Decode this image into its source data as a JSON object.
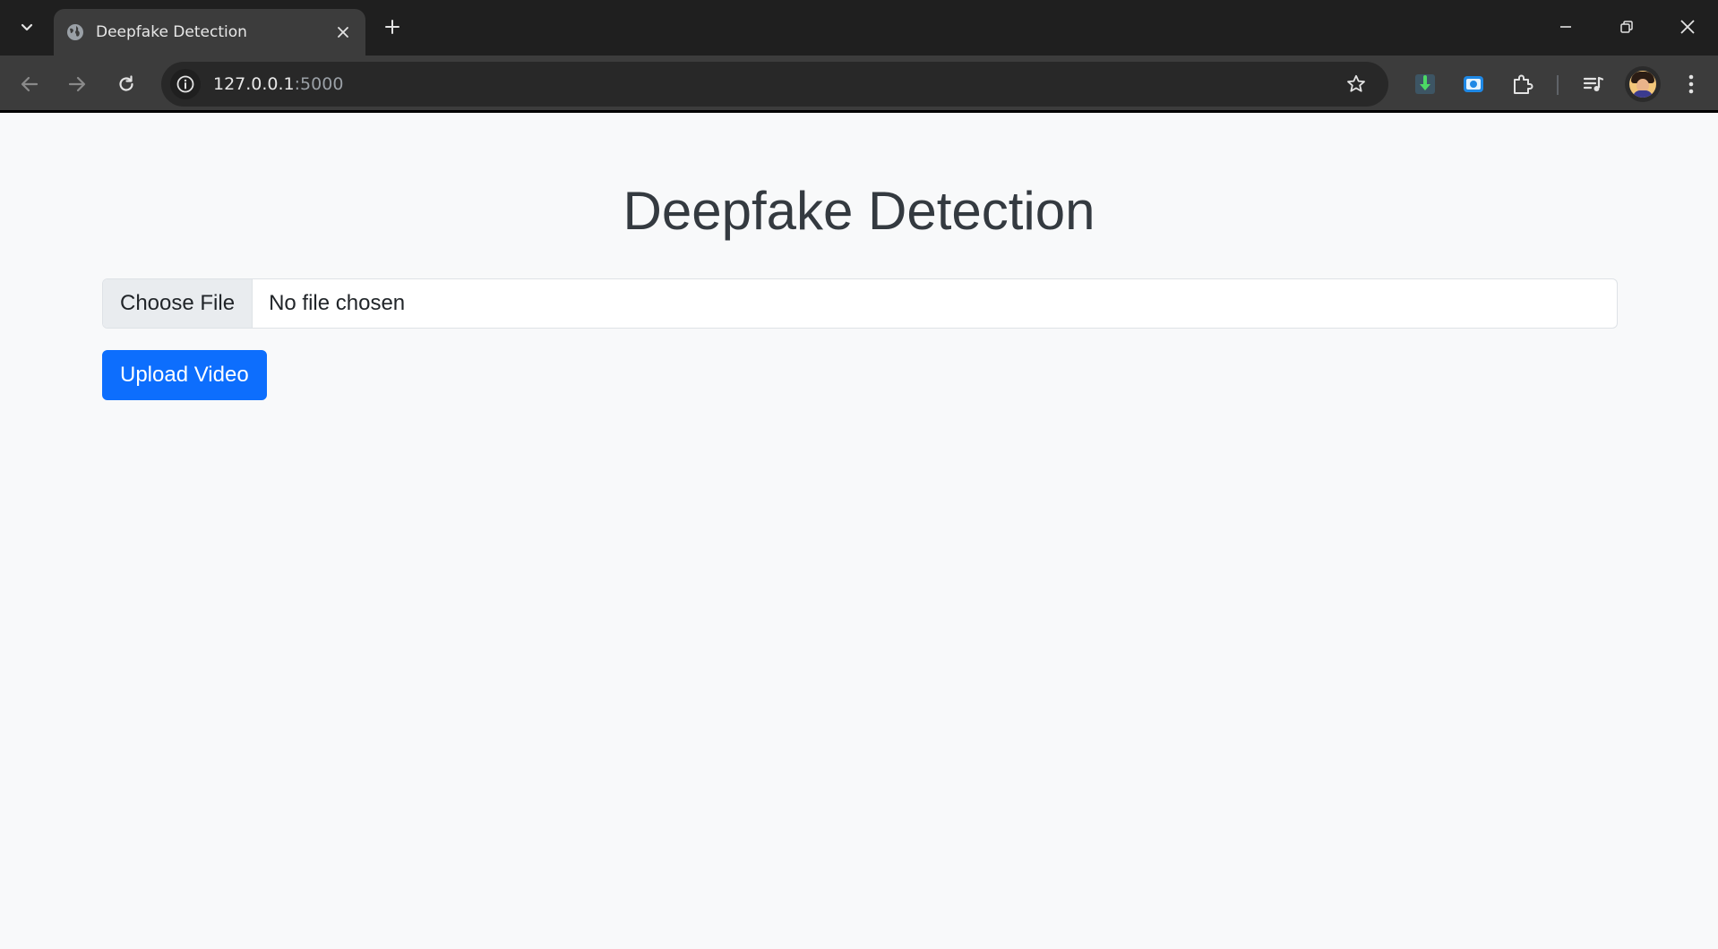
{
  "browser": {
    "tab": {
      "title": "Deepfake Detection",
      "favicon": "globe-icon"
    },
    "address_bar": {
      "host": "127.0.0.1",
      "port": ":5000"
    },
    "toolbar_icons": [
      "back-icon",
      "forward-icon",
      "reload-icon",
      "site-info-icon",
      "bookmark-star-icon",
      "download-extension-icon",
      "screenshot-extension-icon",
      "extensions-puzzle-icon",
      "media-controls-icon",
      "profile-avatar",
      "menu-icon"
    ],
    "window_controls": [
      "minimize-icon",
      "restore-icon",
      "close-icon"
    ]
  },
  "page": {
    "title": "Deepfake Detection",
    "file_input": {
      "button_label": "Choose File",
      "status": "No file chosen"
    },
    "upload_button": "Upload Video"
  },
  "colors": {
    "page_background": "#f8f9fa",
    "title_text": "#343a40",
    "primary_button": "#0d6efd",
    "browser_frame": "#1f1f1f",
    "browser_toolbar": "#3c3c3c"
  }
}
